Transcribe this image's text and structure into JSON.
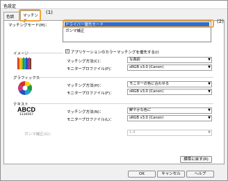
{
  "window": {
    "title": "色設定"
  },
  "tabs": [
    {
      "label": "色調整"
    },
    {
      "label": "マッチング"
    }
  ],
  "callouts": {
    "tab": "(1)",
    "mode": "(2)"
  },
  "matching_mode": {
    "label": "マッチングモード(M)：",
    "options": [
      "ドライバー優先モード",
      "ガンマ補正"
    ],
    "selected": "ドライバー優先モード"
  },
  "app_priority": {
    "label": "アプリケーションのカラーマッチングを優先する(I)",
    "checked": true
  },
  "sections": {
    "image": {
      "title": "イメージ",
      "method_label": "マッチング方法(C)：",
      "method_value": "写真調",
      "profile_label": "モニタープロファイル(P)：",
      "profile_value": "sRGB v3.0 (Canon)"
    },
    "graphics": {
      "title": "グラフィックス",
      "method_label": "マッチング方法(H)：",
      "method_value": "モニターの色に合わせる",
      "profile_label": "モニタープロファイル(F)：",
      "profile_value": "sRGB v3.0 (Canon)"
    },
    "text": {
      "title": "テキスト",
      "method_label": "マッチング方法(N)：",
      "method_value": "鮮やかな色に",
      "profile_label": "モニタープロファイル(L)：",
      "profile_value": "sRGB v3.0 (Canon)",
      "sample_main": "ABCD",
      "sample_sub": "1234567"
    }
  },
  "gamma": {
    "label": "ガンマ補正(G)：",
    "value": "1.4"
  },
  "restore_default": "標準に戻す(R)",
  "buttons": {
    "ok": "OK",
    "cancel": "キャンセル",
    "help": "ヘルプ"
  }
}
